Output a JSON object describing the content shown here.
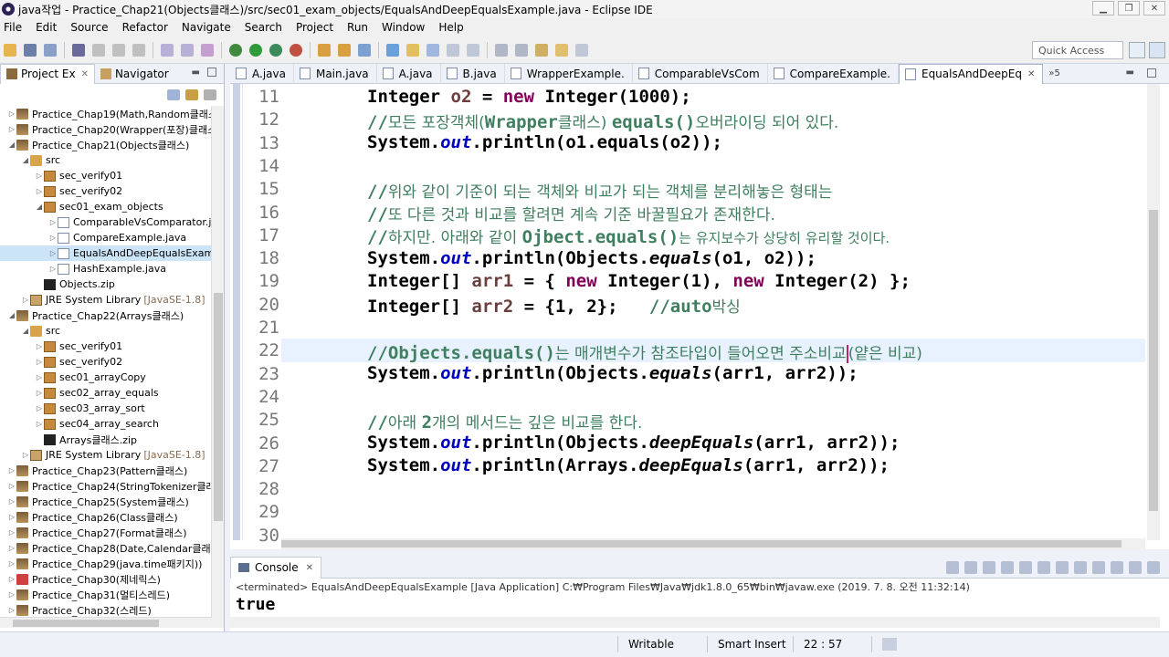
{
  "window": {
    "title": "java작업 - Practice_Chap21(Objects클래스)/src/sec01_exam_objects/EqualsAndDeepEqualsExample.java - Eclipse IDE"
  },
  "menu": [
    "File",
    "Edit",
    "Source",
    "Refactor",
    "Navigate",
    "Search",
    "Project",
    "Run",
    "Window",
    "Help"
  ],
  "toolbar": {
    "quick_access": "Quick Access"
  },
  "left_panel": {
    "tabs": [
      {
        "label": "Project Ex",
        "close": "✕"
      },
      {
        "label": "Navigator"
      }
    ],
    "tree": [
      {
        "label": "Practice_Chap19(Math,Random클래스",
        "depth": 0,
        "arrow": "▷",
        "type": "proj"
      },
      {
        "label": "Practice_Chap20(Wrapper(포장)클래스",
        "depth": 0,
        "arrow": "▷",
        "type": "proj"
      },
      {
        "label": "Practice_Chap21(Objects클래스)",
        "depth": 0,
        "arrow": "◢",
        "type": "proj"
      },
      {
        "label": "src",
        "depth": 1,
        "arrow": "◢",
        "type": "src"
      },
      {
        "label": "sec_verify01",
        "depth": 2,
        "arrow": "▷",
        "type": "pkg"
      },
      {
        "label": "sec_verify02",
        "depth": 2,
        "arrow": "▷",
        "type": "pkg"
      },
      {
        "label": "sec01_exam_objects",
        "depth": 2,
        "arrow": "◢",
        "type": "pkg"
      },
      {
        "label": "ComparableVsComparator.ja",
        "depth": 3,
        "arrow": "▷",
        "type": "java"
      },
      {
        "label": "CompareExample.java",
        "depth": 3,
        "arrow": "▷",
        "type": "java"
      },
      {
        "label": "EqualsAndDeepEqualsExamp",
        "depth": 3,
        "arrow": "▷",
        "type": "java",
        "selected": true
      },
      {
        "label": "HashExample.java",
        "depth": 3,
        "arrow": "▷",
        "type": "java"
      },
      {
        "label": "Objects.zip",
        "depth": 2,
        "arrow": "",
        "type": "zip"
      },
      {
        "label": "JRE System Library",
        "suffix": "[JavaSE-1.8]",
        "depth": 1,
        "arrow": "▷",
        "type": "lib"
      },
      {
        "label": "Practice_Chap22(Arrays클래스)",
        "depth": 0,
        "arrow": "◢",
        "type": "proj"
      },
      {
        "label": "src",
        "depth": 1,
        "arrow": "◢",
        "type": "src"
      },
      {
        "label": "sec_verify01",
        "depth": 2,
        "arrow": "▷",
        "type": "pkg"
      },
      {
        "label": "sec_verify02",
        "depth": 2,
        "arrow": "▷",
        "type": "pkg"
      },
      {
        "label": "sec01_arrayCopy",
        "depth": 2,
        "arrow": "▷",
        "type": "pkg"
      },
      {
        "label": "sec02_array_equals",
        "depth": 2,
        "arrow": "▷",
        "type": "pkg"
      },
      {
        "label": "sec03_array_sort",
        "depth": 2,
        "arrow": "▷",
        "type": "pkg"
      },
      {
        "label": "sec04_array_search",
        "depth": 2,
        "arrow": "▷",
        "type": "pkg"
      },
      {
        "label": "Arrays클래스.zip",
        "depth": 2,
        "arrow": "",
        "type": "zip"
      },
      {
        "label": "JRE System Library",
        "suffix": "[JavaSE-1.8]",
        "depth": 1,
        "arrow": "▷",
        "type": "lib"
      },
      {
        "label": "Practice_Chap23(Pattern클래스)",
        "depth": 0,
        "arrow": "▷",
        "type": "proj"
      },
      {
        "label": "Practice_Chap24(StringTokenizer클래",
        "depth": 0,
        "arrow": "▷",
        "type": "proj"
      },
      {
        "label": "Practice_Chap25(System클래스)",
        "depth": 0,
        "arrow": "▷",
        "type": "proj"
      },
      {
        "label": "Practice_Chap26(Class클래스)",
        "depth": 0,
        "arrow": "▷",
        "type": "proj"
      },
      {
        "label": "Practice_Chap27(Format클래스)",
        "depth": 0,
        "arrow": "▷",
        "type": "proj"
      },
      {
        "label": "Practice_Chap28(Date,Calendar클래스",
        "depth": 0,
        "arrow": "▷",
        "type": "proj"
      },
      {
        "label": "Practice_Chap29(java.time패키지))",
        "depth": 0,
        "arrow": "▷",
        "type": "proj"
      },
      {
        "label": "Practice_Chap30(제네릭스)",
        "depth": 0,
        "arrow": "▷",
        "type": "proj-err"
      },
      {
        "label": "Practice_Chap31(멀티스레드)",
        "depth": 0,
        "arrow": "▷",
        "type": "proj"
      },
      {
        "label": "Practice_Chap32(스레드)",
        "depth": 0,
        "arrow": "▷",
        "type": "proj"
      }
    ]
  },
  "editor": {
    "tabs": [
      {
        "label": "A.java"
      },
      {
        "label": "Main.java"
      },
      {
        "label": "A.java"
      },
      {
        "label": "B.java"
      },
      {
        "label": "WrapperExample."
      },
      {
        "label": "ComparableVsCom"
      },
      {
        "label": "CompareExample."
      },
      {
        "label": "EqualsAndDeepEq",
        "active": true
      }
    ],
    "more_tabs": "»5",
    "highlight_line": 22,
    "lines": [
      {
        "no": "11"
      },
      {
        "no": "12"
      },
      {
        "no": "13"
      },
      {
        "no": "14"
      },
      {
        "no": "15"
      },
      {
        "no": "16"
      },
      {
        "no": "17"
      },
      {
        "no": "18"
      },
      {
        "no": "19"
      },
      {
        "no": "20"
      },
      {
        "no": "21"
      },
      {
        "no": "22"
      },
      {
        "no": "23"
      },
      {
        "no": "24"
      },
      {
        "no": "25"
      },
      {
        "no": "26"
      },
      {
        "no": "27"
      },
      {
        "no": "28"
      },
      {
        "no": "29"
      },
      {
        "no": "30"
      }
    ],
    "code": {
      "l11": {
        "t1": "Integer ",
        "v": "o2",
        "t2": " = ",
        "kw": "new",
        "t3": " Integer(1000);"
      },
      "l12": {
        "c1": "//",
        "k1": "모든 포장객체(",
        "c2": "Wrapper",
        "k2": "클래스) ",
        "c3": "equals()",
        "k3": "오버라이딩 되어 있다."
      },
      "l13": {
        "t1": "System.",
        "it": "out",
        "t2": ".println(o1.equals(o2));"
      },
      "l15": {
        "c1": "//",
        "k1": "위와 같이 기준이 되는 객체와 비교가 되는 객체를 분리해놓은 형태는"
      },
      "l16": {
        "c1": "//",
        "k1": "또 다른 것과 비교를 할려면 계속 기준 바꿀필요가 존재한다."
      },
      "l17": {
        "c1": "//",
        "k1": "하지만. 아래와 같이 ",
        "c2": "Ojbect.equals()",
        "k2": "는 유지보수가 상당히 유리할 것이다."
      },
      "l18": {
        "t1": "System.",
        "it": "out",
        "t2": ".println(Objects.",
        "sit": "equals",
        "t3": "(o1, o2));"
      },
      "l19": {
        "t1": "Integer[] ",
        "v": "arr1",
        "t2": " = { ",
        "kw1": "new",
        "t3": " Integer(1), ",
        "kw2": "new",
        "t4": " Integer(2) };"
      },
      "l20": {
        "t1": "Integer[] ",
        "v": "arr2",
        "t2": " = {1, 2};   ",
        "c1": "//auto",
        "k1": "박싱"
      },
      "l22": {
        "c1": "//Objects.equals()",
        "k1": "는 매개변수가 참조타입이 들어오면 주소비교",
        "k2": "(얕은 비교)"
      },
      "l23": {
        "t1": "System.",
        "it": "out",
        "t2": ".println(Objects.",
        "sit": "equals",
        "t3": "(arr1, arr2));"
      },
      "l25": {
        "c1": "//",
        "k1": "아래 ",
        "c2": "2",
        "k2": "개의 메서드는 깊은 비교를 한다."
      },
      "l26": {
        "t1": "System.",
        "it": "out",
        "t2": ".println(Objects.",
        "sit": "deepEquals",
        "t3": "(arr1, arr2));"
      },
      "l27": {
        "t1": "System.",
        "it": "out",
        "t2": ".println(Arrays.",
        "sit": "deepEquals",
        "t3": "(arr1, arr2));"
      }
    }
  },
  "console": {
    "tab_label": "Console",
    "status": "<terminated> EqualsAndDeepEqualsExample [Java Application] C:₩Program Files₩Java₩jdk1.8.0_65₩bin₩javaw.exe (2019. 7. 8. 오전 11:32:14)",
    "output": "true"
  },
  "statusbar": {
    "writable": "Writable",
    "insert_mode": "Smart Insert",
    "position": "22 : 57"
  },
  "colors": {
    "keyword": "#7f0055",
    "comment": "#3f7f5f",
    "field": "#0000c0",
    "local_var": "#6a3e3e",
    "selection": "#cce4f7",
    "current_line": "#e8f2fe"
  }
}
